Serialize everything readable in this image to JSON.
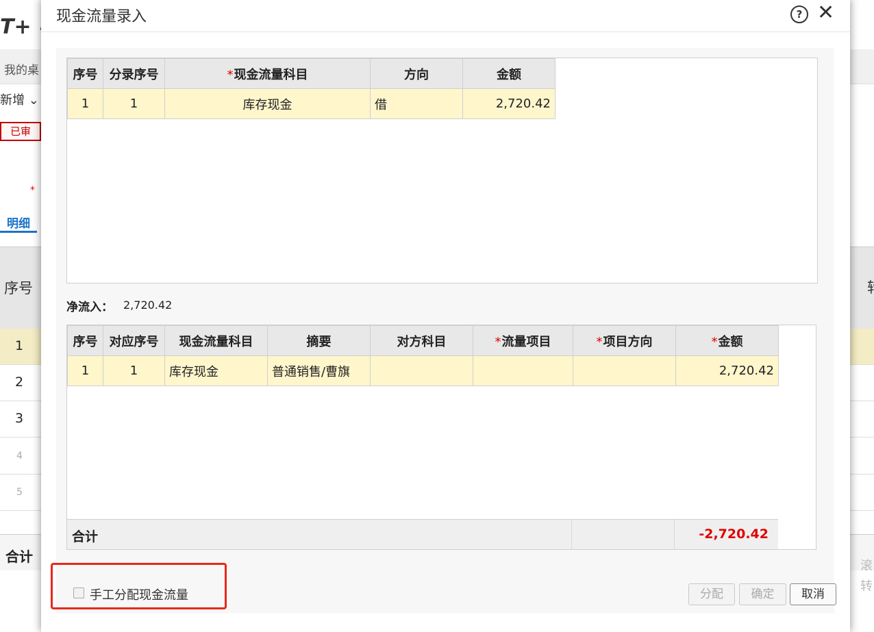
{
  "background": {
    "logo": "T+ 畅",
    "tab_desk": "我的桌",
    "add_menu": "新增 ⌄",
    "status_badge": "已审",
    "required_mark": "*",
    "detail_tab": "明细",
    "grid_header_seq": "序号",
    "grid_header_right": "转",
    "rows": [
      "1",
      "2",
      "3",
      "4",
      "5"
    ],
    "total_label": "合计",
    "hint": "滚 转"
  },
  "modal": {
    "title": "现金流量录入",
    "help_icon": "?",
    "close_icon": "✕",
    "top_table": {
      "headers": [
        "序号",
        "分录序号",
        "现金流量科目",
        "方向",
        "金额"
      ],
      "required_cols": [
        2
      ],
      "rows": [
        {
          "seq": "1",
          "entry_seq": "1",
          "account": "库存现金",
          "direction": "借",
          "amount": "2,720.42"
        }
      ]
    },
    "net_inflow_label": "净流入：",
    "net_inflow_value": "2,720.42",
    "bottom_table": {
      "headers": [
        "序号",
        "对应序号",
        "现金流量科目",
        "摘要",
        "对方科目",
        "流量项目",
        "项目方向",
        "金额"
      ],
      "required_cols": [
        5,
        6,
        7
      ],
      "rows": [
        {
          "seq": "1",
          "ref_seq": "1",
          "account": "库存现金",
          "summary": "普通销售/曹旗",
          "counter_account": "",
          "flow_item": "",
          "item_direction": "",
          "amount": "2,720.42"
        }
      ],
      "total_label": "合计",
      "total_value": "-2,720.42"
    },
    "manual_allocate_label": "手工分配现金流量",
    "manual_allocate_checked": false,
    "buttons": {
      "allocate": "分配",
      "confirm": "确定",
      "cancel": "取消"
    },
    "colors": {
      "row_highlight": "#fff6cc",
      "required_star": "#e00000",
      "total_value": "#e00000",
      "callout_box": "#e8271a"
    }
  }
}
